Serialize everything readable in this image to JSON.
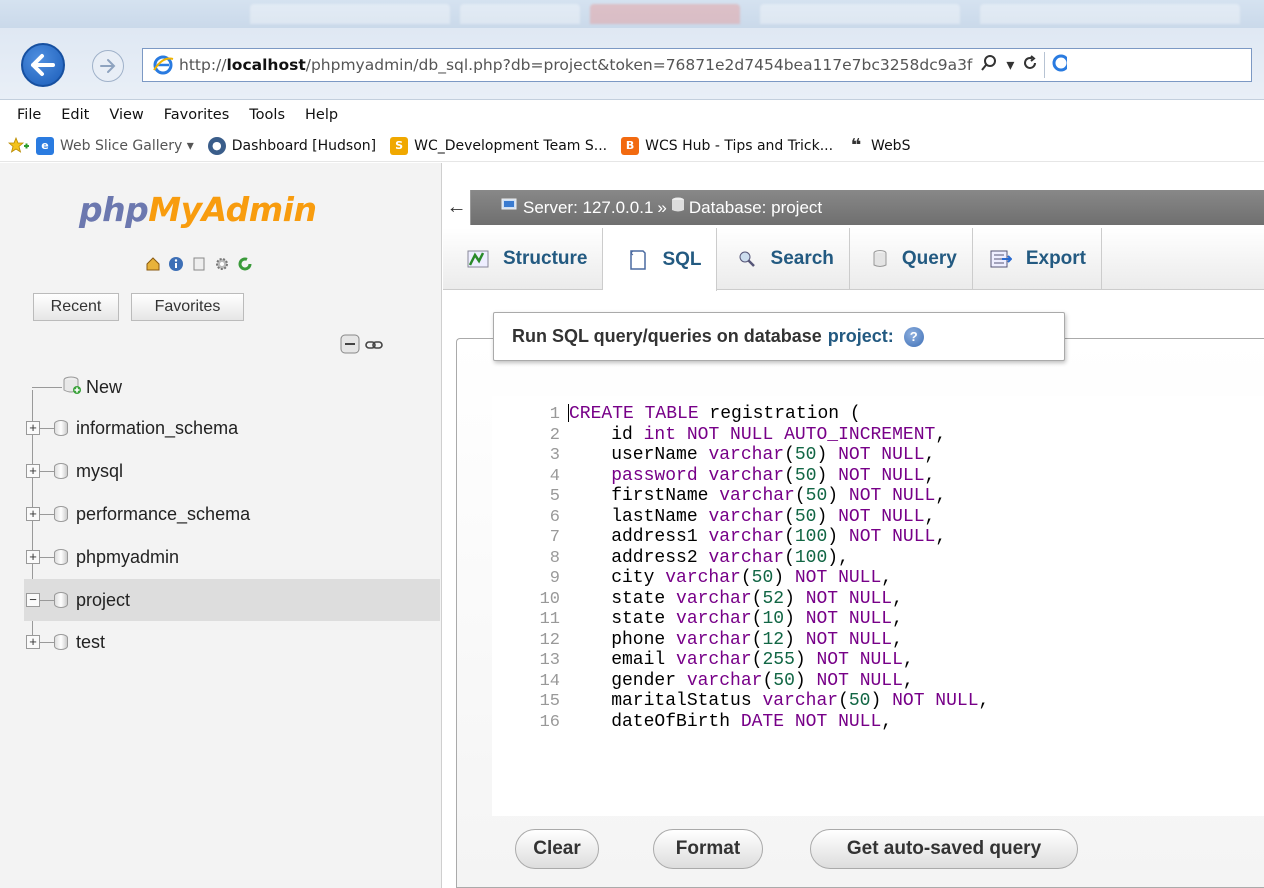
{
  "browser": {
    "url_prefix": "http://",
    "url_host": "localhost",
    "url_path": "/phpmyadmin/db_sql.php?db=project&token=76871e2d7454bea117e7bc3258dc9a3f",
    "menu": [
      "File",
      "Edit",
      "View",
      "Favorites",
      "Tools",
      "Help"
    ],
    "favorites": [
      {
        "label": "Web Slice Gallery ▾",
        "icon": "web-slice-icon"
      },
      {
        "label": "Dashboard [Hudson]",
        "icon": "hudson-icon"
      },
      {
        "label": "WC_Development Team S...",
        "icon": "sharepoint-icon"
      },
      {
        "label": "WCS Hub - Tips and Trick...",
        "icon": "blogger-icon"
      },
      {
        "label": "WebS",
        "icon": "quote-icon"
      }
    ]
  },
  "pma": {
    "logo_php": "php",
    "logo_myadmin": "MyAdmin",
    "recent_label": "Recent",
    "favorites_label": "Favorites",
    "tree": [
      {
        "label": "New",
        "type": "new"
      },
      {
        "label": "information_schema",
        "type": "db"
      },
      {
        "label": "mysql",
        "type": "db"
      },
      {
        "label": "performance_schema",
        "type": "db"
      },
      {
        "label": "phpmyadmin",
        "type": "db"
      },
      {
        "label": "project",
        "type": "db",
        "selected": true
      },
      {
        "label": "test",
        "type": "db"
      }
    ]
  },
  "breadcrumb": {
    "server": "Server: 127.0.0.1",
    "sep": "»",
    "database": "Database: project"
  },
  "tabs": [
    {
      "label": "Structure",
      "icon": "structure-icon"
    },
    {
      "label": "SQL",
      "icon": "sql-icon",
      "active": true
    },
    {
      "label": "Search",
      "icon": "search-icon"
    },
    {
      "label": "Query",
      "icon": "query-icon"
    },
    {
      "label": "Export",
      "icon": "export-icon"
    }
  ],
  "sql_panel": {
    "legend_text": "Run SQL query/queries on database",
    "legend_db": "project:",
    "buttons": {
      "clear": "Clear",
      "format": "Format",
      "autosaved": "Get auto-saved query"
    }
  },
  "code": [
    {
      "n": "1",
      "text": "CREATE TABLE registration ("
    },
    {
      "n": "2",
      "text": "    id int NOT NULL AUTO_INCREMENT,"
    },
    {
      "n": "3",
      "text": "    userName varchar(50) NOT NULL,"
    },
    {
      "n": "4",
      "text": "    password varchar(50) NOT NULL,"
    },
    {
      "n": "5",
      "text": "    firstName varchar(50) NOT NULL,"
    },
    {
      "n": "6",
      "text": "    lastName varchar(50) NOT NULL,"
    },
    {
      "n": "7",
      "text": "    address1 varchar(100) NOT NULL,"
    },
    {
      "n": "8",
      "text": "    address2 varchar(100),"
    },
    {
      "n": "9",
      "text": "    city varchar(50) NOT NULL,"
    },
    {
      "n": "10",
      "text": "    state varchar(52) NOT NULL,"
    },
    {
      "n": "11",
      "text": "    state varchar(10) NOT NULL,"
    },
    {
      "n": "12",
      "text": "    phone varchar(12) NOT NULL,"
    },
    {
      "n": "13",
      "text": "    email varchar(255) NOT NULL,"
    },
    {
      "n": "14",
      "text": "    gender varchar(50) NOT NULL,"
    },
    {
      "n": "15",
      "text": "    maritalStatus varchar(50) NOT NULL,"
    },
    {
      "n": "16",
      "text": "    dateOfBirth DATE NOT NULL,"
    }
  ]
}
